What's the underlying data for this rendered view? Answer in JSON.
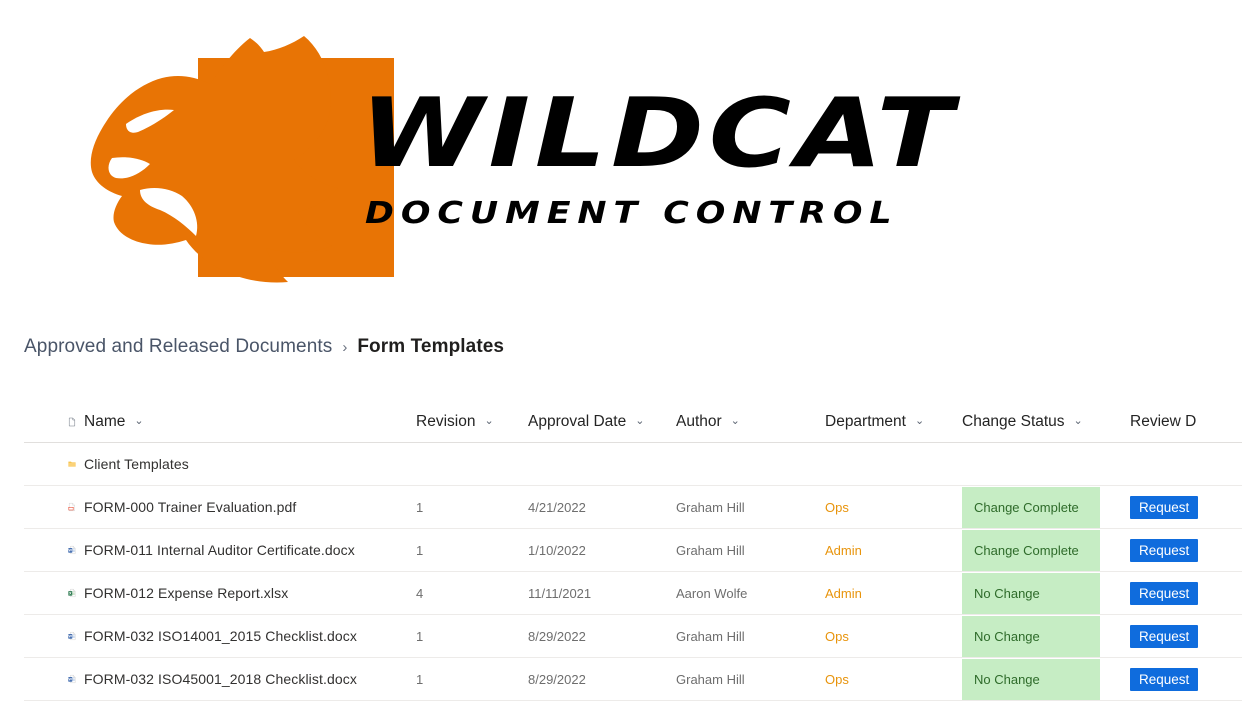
{
  "brand": {
    "logo_icon": "wildcat-head-icon",
    "name": "WILDCAT",
    "tagline": "DOCUMENT CONTROL",
    "orange": "#e87405"
  },
  "breadcrumb": {
    "parent": "Approved and Released Documents",
    "separator": "›",
    "current": "Form Templates"
  },
  "table": {
    "sort_chevron": "⌄",
    "columns": [
      {
        "key": "icon",
        "label": "",
        "icon": "file-type-icon",
        "sortable": false
      },
      {
        "key": "name",
        "label": "Name",
        "sortable": true
      },
      {
        "key": "revision",
        "label": "Revision",
        "sortable": true
      },
      {
        "key": "approval_date",
        "label": "Approval Date",
        "sortable": true
      },
      {
        "key": "author",
        "label": "Author",
        "sortable": true
      },
      {
        "key": "department",
        "label": "Department",
        "sortable": true
      },
      {
        "key": "change_status",
        "label": "Change Status",
        "sortable": true
      },
      {
        "key": "review_date",
        "label": "Review D",
        "sortable": false
      }
    ],
    "colors": {
      "status_background": "#c6edc4",
      "status_text": "#2e6b2a",
      "department_text": "#e8940c",
      "button_background": "#0f6cdd"
    },
    "request_button_label": "Request",
    "rows": [
      {
        "icon": "folder-icon",
        "name": "Client Templates",
        "revision": "",
        "approval_date": "",
        "author": "",
        "department": "",
        "change_status": "",
        "has_status": false,
        "has_request": false
      },
      {
        "icon": "pdf-file-icon",
        "name": "FORM-000 Trainer Evaluation.pdf",
        "revision": "1",
        "approval_date": "4/21/2022",
        "author": "Graham Hill",
        "department": "Ops",
        "change_status": "Change Complete",
        "has_status": true,
        "has_request": true
      },
      {
        "icon": "word-file-icon",
        "name": "FORM-011 Internal Auditor Certificate.docx",
        "revision": "1",
        "approval_date": "1/10/2022",
        "author": "Graham Hill",
        "department": "Admin",
        "change_status": "Change Complete",
        "has_status": true,
        "has_request": true
      },
      {
        "icon": "excel-file-icon",
        "name": "FORM-012 Expense Report.xlsx",
        "revision": "4",
        "approval_date": "11/11/2021",
        "author": "Aaron Wolfe",
        "department": "Admin",
        "change_status": "No Change",
        "has_status": true,
        "has_request": true
      },
      {
        "icon": "word-file-icon",
        "name": "FORM-032 ISO14001_2015 Checklist.docx",
        "revision": "1",
        "approval_date": "8/29/2022",
        "author": "Graham Hill",
        "department": "Ops",
        "change_status": "No Change",
        "has_status": true,
        "has_request": true
      },
      {
        "icon": "word-file-icon",
        "name": "FORM-032 ISO45001_2018 Checklist.docx",
        "revision": "1",
        "approval_date": "8/29/2022",
        "author": "Graham Hill",
        "department": "Ops",
        "change_status": "No Change",
        "has_status": true,
        "has_request": true
      }
    ]
  }
}
